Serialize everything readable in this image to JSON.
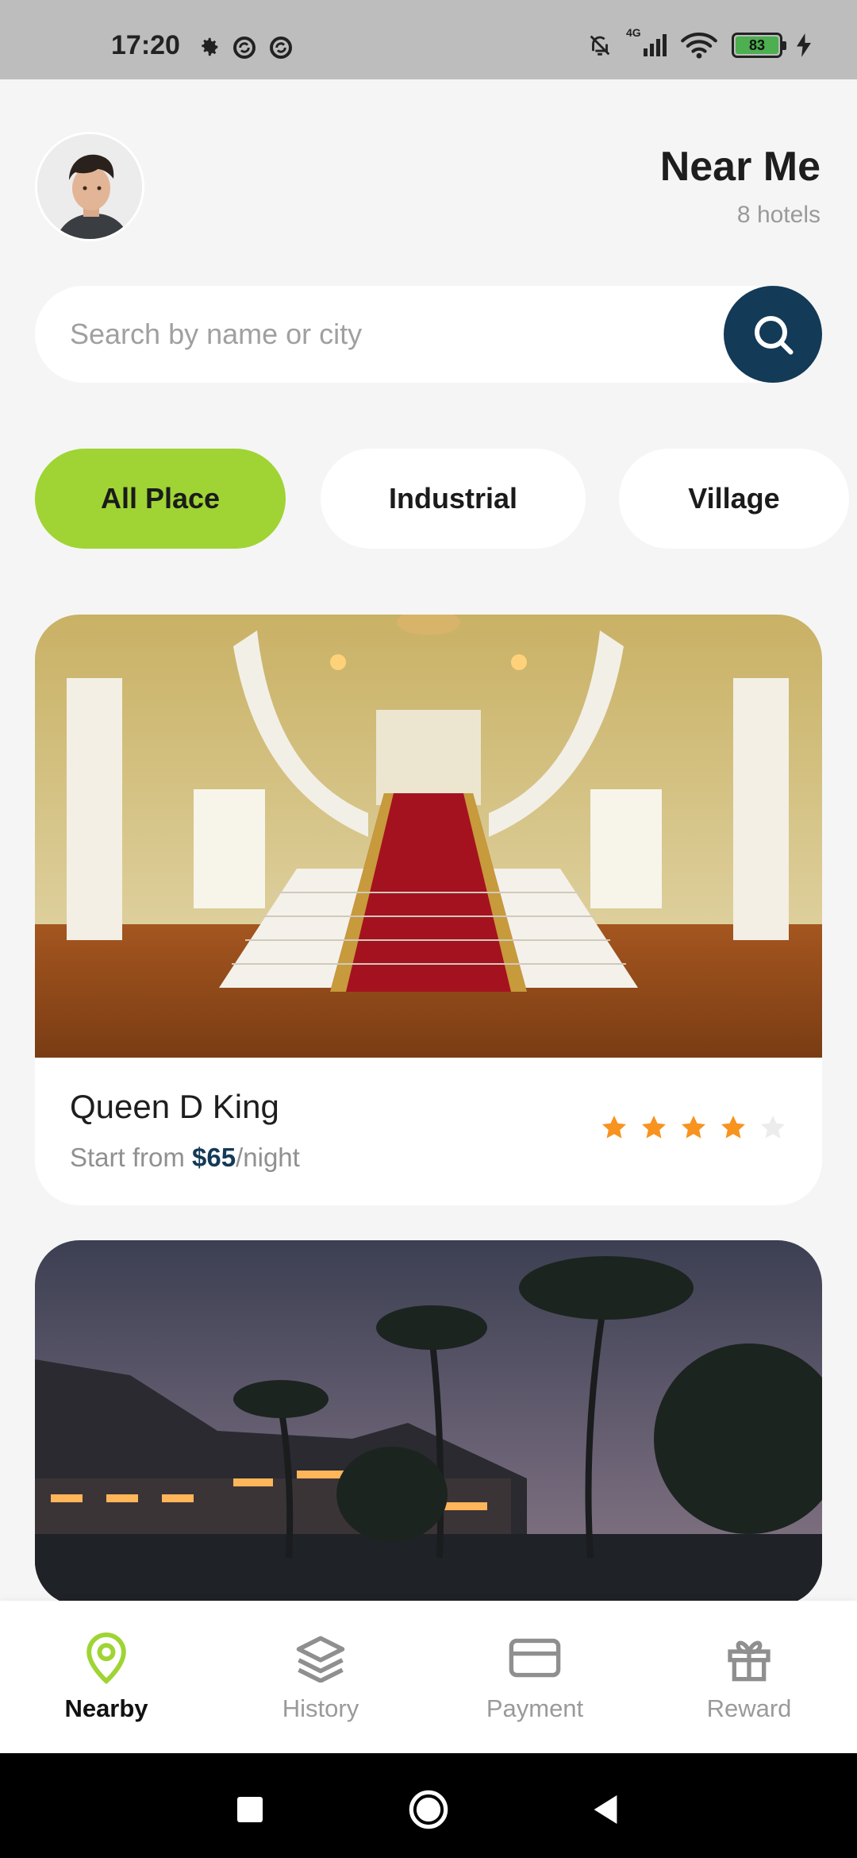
{
  "status_bar": {
    "time": "17:20",
    "network": "4G",
    "battery": "83"
  },
  "header": {
    "title": "Near Me",
    "subtitle": "8 hotels"
  },
  "search": {
    "placeholder": "Search by name or city"
  },
  "categories": [
    {
      "label": "All Place",
      "active": true
    },
    {
      "label": "Industrial",
      "active": false
    },
    {
      "label": "Village",
      "active": false
    }
  ],
  "hotels": [
    {
      "name": "Queen D King",
      "price_prefix": "Start from ",
      "price": "$65",
      "price_suffix": "/night",
      "rating": 4,
      "max_rating": 5
    },
    {
      "name": "",
      "image": "tropical resort at dusk with palm trees"
    }
  ],
  "bottom_nav": [
    {
      "label": "Nearby",
      "icon": "location-pin-icon",
      "active": true
    },
    {
      "label": "History",
      "icon": "layers-icon",
      "active": false
    },
    {
      "label": "Payment",
      "icon": "credit-card-icon",
      "active": false
    },
    {
      "label": "Reward",
      "icon": "gift-icon",
      "active": false
    }
  ],
  "colors": {
    "accent_green": "#9fd434",
    "primary_navy": "#133a57",
    "star_orange": "#f7931e",
    "background": "#f5f5f5"
  }
}
